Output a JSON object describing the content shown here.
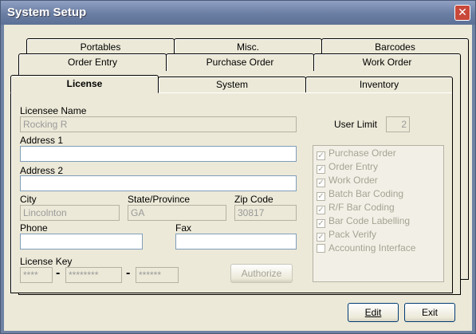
{
  "window": {
    "title": "System Setup",
    "close_glyph": "✕"
  },
  "tabs": {
    "row1": [
      "Portables",
      "Misc.",
      "Barcodes"
    ],
    "row2": [
      "Order Entry",
      "Purchase Order",
      "Work Order"
    ],
    "row3": [
      "License",
      "System",
      "Inventory"
    ]
  },
  "form": {
    "licensee_label": "Licensee Name",
    "licensee_value": "Rocking R",
    "user_limit_label": "User Limit",
    "user_limit_value": "2",
    "address1_label": "Address 1",
    "address1_value": "",
    "address2_label": "Address 2",
    "address2_value": "",
    "city_label": "City",
    "city_value": "Lincolnton",
    "state_label": "State/Province",
    "state_value": "GA",
    "zip_label": "Zip Code",
    "zip_value": "30817",
    "phone_label": "Phone",
    "phone_value": "",
    "fax_label": "Fax",
    "fax_value": "",
    "license_key_label": "License Key",
    "key1": "****",
    "key2": "********",
    "key3": "******",
    "dash": "-",
    "authorize_label": "Authorize"
  },
  "modules": {
    "check_glyph": "✓",
    "items": [
      {
        "label": "Purchase Order",
        "checked": true
      },
      {
        "label": "Order Entry",
        "checked": true
      },
      {
        "label": "Work Order",
        "checked": true
      },
      {
        "label": "Batch Bar Coding",
        "checked": true
      },
      {
        "label": "R/F Bar Coding",
        "checked": true
      },
      {
        "label": "Bar Code Labelling",
        "checked": true
      },
      {
        "label": "Pack Verify",
        "checked": true
      },
      {
        "label": "Accounting Interface",
        "checked": false
      }
    ]
  },
  "buttons": {
    "edit": "Edit",
    "exit": "Exit"
  }
}
